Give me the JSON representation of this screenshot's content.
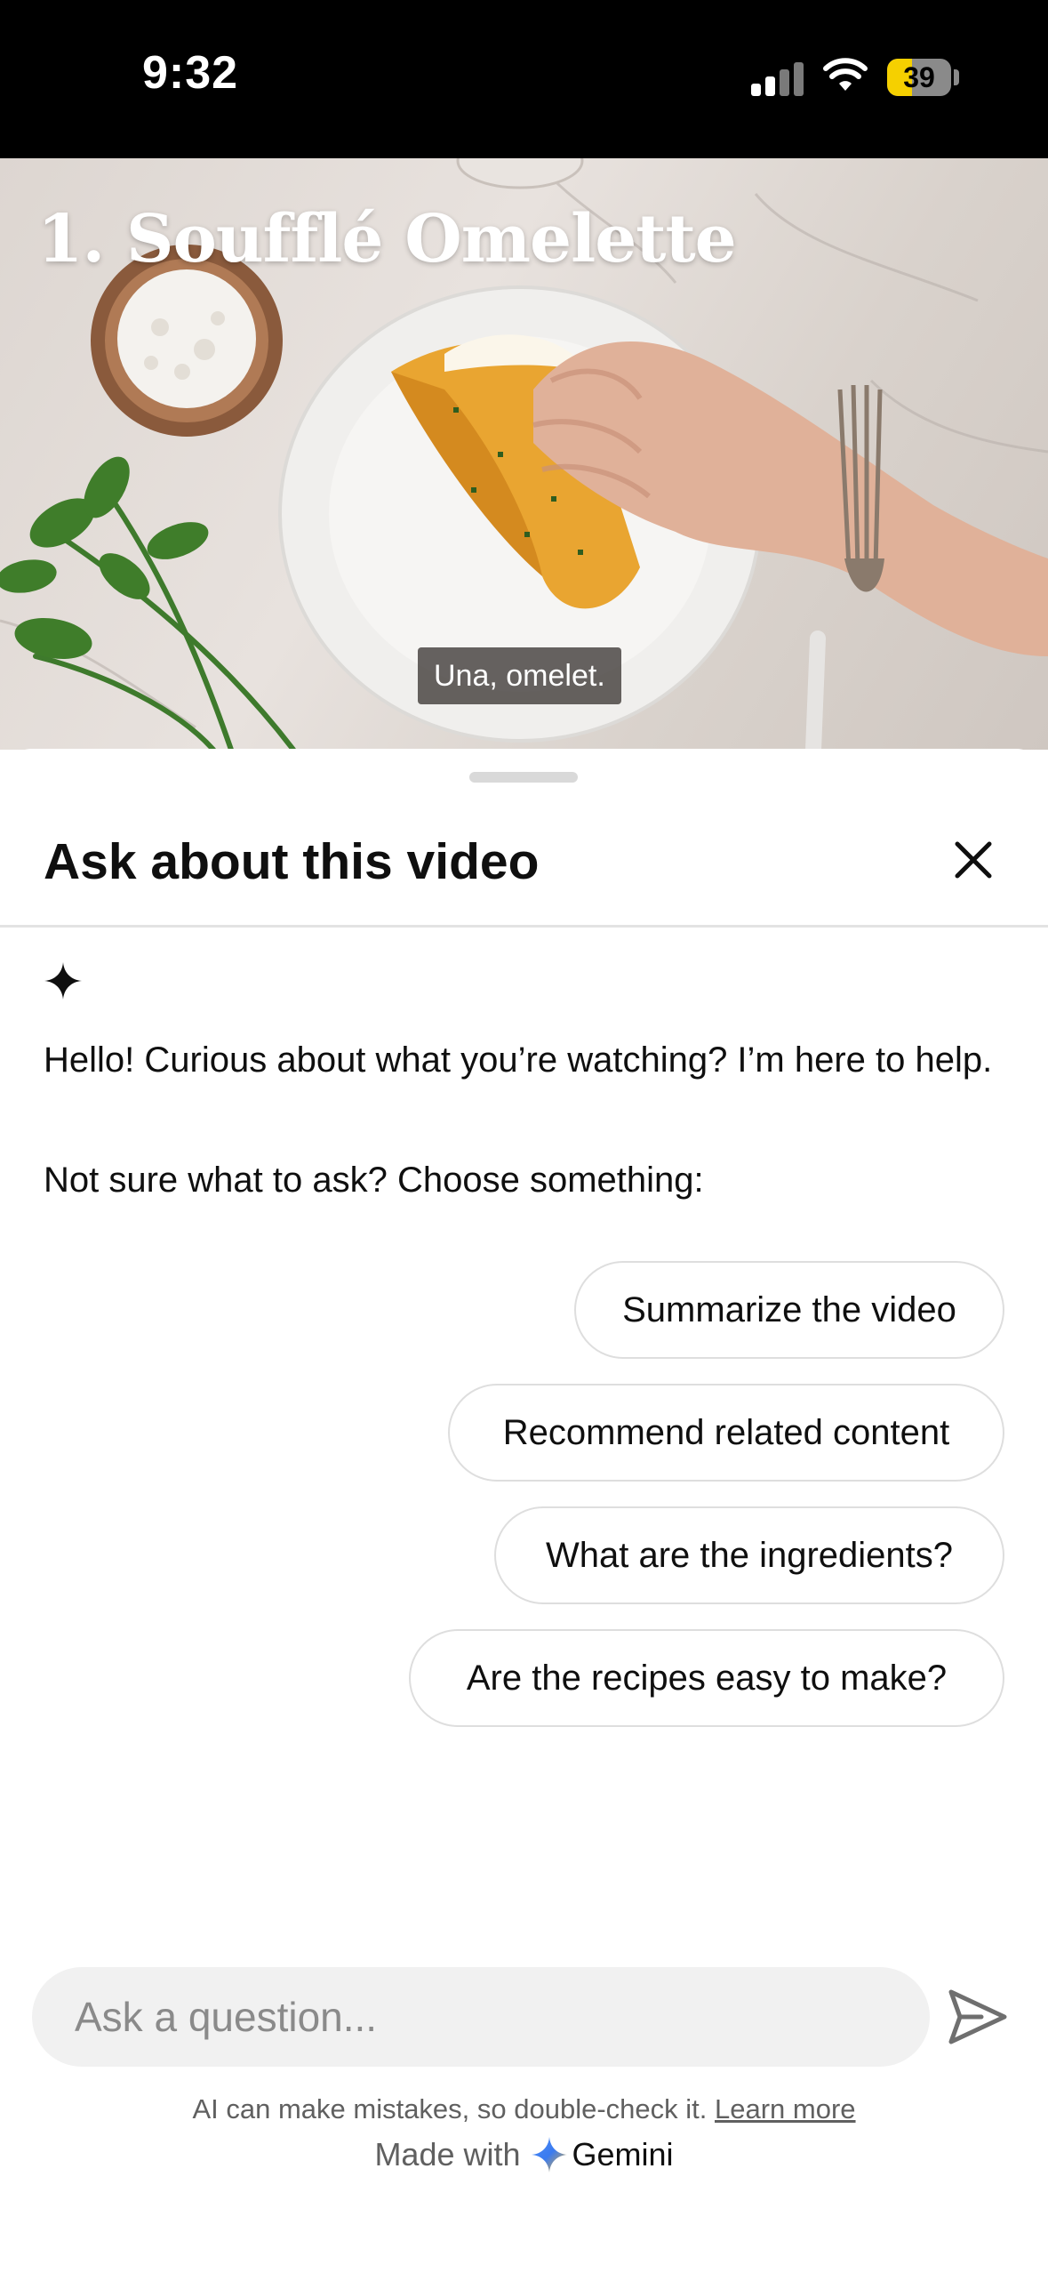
{
  "status_bar": {
    "time": "9:32",
    "battery_level": "39",
    "battery_fraction": 0.39,
    "icons": [
      "cellular-signal-icon",
      "wifi-icon",
      "battery-icon"
    ]
  },
  "video": {
    "title": "1. Soufflé Omelette",
    "caption": "Una, omelet.",
    "progress_fraction": 0.06
  },
  "sheet": {
    "title": "Ask about this video",
    "close_icon": "close-icon",
    "assistant_icon": "sparkle-icon",
    "greeting": "Hello! Curious about what you’re watching? I’m here to help.",
    "prompt": "Not sure what to ask? Choose something:",
    "suggestions": [
      "Summarize the video",
      "Recommend related content",
      "What are the ingredients?",
      "Are the recipes easy to make?"
    ]
  },
  "input": {
    "placeholder": "Ask a question...",
    "value": "",
    "send_icon": "send-icon"
  },
  "footer": {
    "disclaimer": "AI can make mistakes, so double-check it.",
    "learn_more": "Learn more",
    "made_with": "Made with",
    "brand": "Gemini"
  },
  "colors": {
    "status_bar_bg": "#000000",
    "battery_accent": "#f5d000",
    "chip_border": "#dedede",
    "input_bg": "#f1f1f1"
  }
}
